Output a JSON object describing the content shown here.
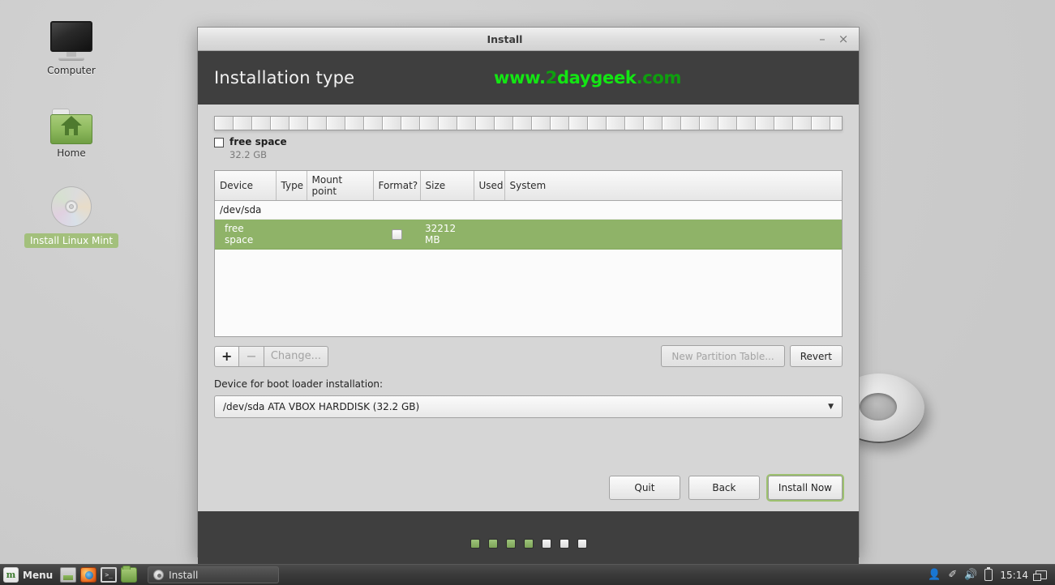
{
  "desktop": {
    "icons": [
      {
        "name": "Computer",
        "icon": "monitor-icon",
        "selected": false
      },
      {
        "name": "Home",
        "icon": "home-folder-icon",
        "selected": false
      },
      {
        "name": "Install Linux Mint",
        "icon": "cd-disc-icon",
        "selected": true
      }
    ]
  },
  "window": {
    "title": "Install",
    "minimize_label": "–",
    "close_label": "×",
    "header": {
      "title": "Installation type",
      "watermark_prefix": "www.",
      "watermark_dot": "2",
      "watermark_main": "daygeek",
      "watermark_suffix": ".com",
      "watermark_color": "#13e613"
    },
    "legend": {
      "label": "free space",
      "size": "32.2 GB"
    },
    "table": {
      "columns": [
        "Device",
        "Type",
        "Mount point",
        "Format?",
        "Size",
        "Used",
        "System"
      ],
      "rows": [
        {
          "type": "disk",
          "device": "/dev/sda",
          "dtype": "",
          "mount": "",
          "format": false,
          "size": "",
          "used": "",
          "system": "",
          "selected": false
        },
        {
          "type": "partition",
          "device": "free space",
          "dtype": "",
          "mount": "",
          "format": true,
          "size": "32212 MB",
          "used": "",
          "system": "",
          "selected": true
        }
      ]
    },
    "toolbar": {
      "add_label": "+",
      "remove_label": "−",
      "change_label": "Change...",
      "new_partition_table_label": "New Partition Table...",
      "revert_label": "Revert",
      "add_enabled": true,
      "remove_enabled": false,
      "change_enabled": false,
      "new_partition_table_enabled": false,
      "revert_enabled": true
    },
    "bootloader": {
      "label": "Device for boot loader installation:",
      "selected": "/dev/sda ATA VBOX HARDDISK (32.2 GB)",
      "arrow": "▼"
    },
    "actions": {
      "quit_label": "Quit",
      "back_label": "Back",
      "install_label": "Install Now",
      "install_accent": "#9dc16f"
    },
    "footer": {
      "total_steps": 7,
      "completed_steps": 4,
      "dot_on_color": "#8fb368",
      "dot_off_color": "#eeeeee"
    }
  },
  "taskbar": {
    "menu_label": "Menu",
    "logo_text": "m",
    "launchers": [
      {
        "name": "show-desktop-icon"
      },
      {
        "name": "firefox-icon"
      },
      {
        "name": "terminal-icon",
        "glyph": ">_"
      },
      {
        "name": "files-icon"
      }
    ],
    "task_label": "Install",
    "tray": {
      "user_icon": "●",
      "update_icon": "✐",
      "volume_icon": "◀))",
      "battery_icon": "battery-icon",
      "clock": "15:14",
      "workspace_icon": "workspace-switcher-icon"
    }
  }
}
